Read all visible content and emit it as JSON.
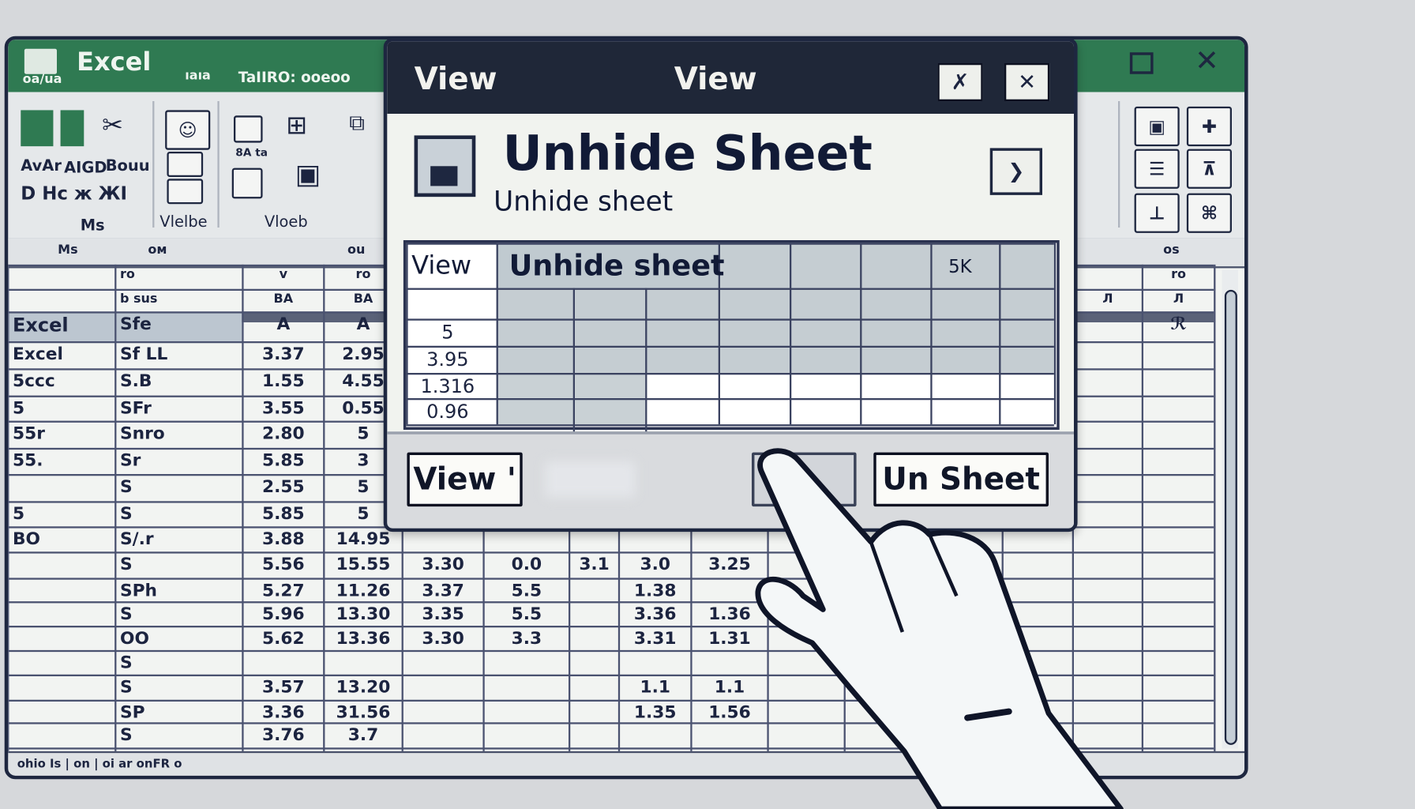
{
  "colors": {
    "excel_green": "#2f7a52",
    "dialog_title": "#1f2738",
    "grid_line": "#4a5270",
    "selection": "#bcc6d0"
  },
  "titlebar": {
    "app_name": "Excel",
    "left_caption": "oa/ua",
    "mid_caption": "ıaıa",
    "right_caption": "TaIIRO: ооеоо",
    "maximize_icon": "maximize-icon",
    "close_icon": "close-icon"
  },
  "ribbon": {
    "group_labels": [
      "Ms",
      "Vlelbe",
      "Vloeb"
    ],
    "small_text": [
      "AvAr",
      "AIGD",
      "Воuu",
      "D Hc ж ЖI",
      "8А ta"
    ]
  },
  "colstrip": {
    "labels": [
      "Ms",
      "ом",
      "ou",
      "os"
    ]
  },
  "sheet": {
    "rows": [
      [
        "",
        "ro",
        "v",
        "ro",
        "",
        "",
        "",
        "",
        "",
        "",
        "",
        "",
        "",
        "",
        "ro"
      ],
      [
        "",
        "b sus",
        "BA",
        "BA",
        "",
        "",
        "",
        "",
        "",
        "",
        "",
        "",
        "",
        "Л",
        "Л"
      ],
      [
        "Excel",
        "Sfe",
        "A",
        "A",
        "",
        "",
        "",
        "",
        "",
        "",
        "",
        "",
        "",
        "",
        "ℛ"
      ],
      [
        "Excel",
        "Sf LL",
        "3.37",
        "2.95"
      ],
      [
        "5ccc",
        "S.B",
        "1.55",
        "4.55"
      ],
      [
        "5",
        "SFr",
        "3.55",
        "0.55"
      ],
      [
        "55r",
        "Snro",
        "2.80",
        "5"
      ],
      [
        "55.",
        "Sr",
        "5.85",
        "3"
      ],
      [
        "",
        "S",
        "2.55",
        "5"
      ],
      [
        "5",
        "S",
        "5.85",
        "5"
      ],
      [
        "BO",
        "S/.r",
        "3.88",
        "14.95"
      ],
      [
        "",
        "S",
        "5.56",
        "15.55",
        "3.30",
        "0.0",
        "3.1",
        "3.0",
        "3.25"
      ],
      [
        "",
        "SPh",
        "5.27",
        "11.26",
        "3.37",
        "5.5",
        "",
        "1.38",
        ""
      ],
      [
        "",
        "S",
        "5.96",
        "13.30",
        "3.35",
        "5.5",
        "",
        "3.36",
        "1.36"
      ],
      [
        "",
        "OO",
        "5.62",
        "13.36",
        "3.30",
        "3.3",
        "",
        "3.31",
        "1.31"
      ],
      [
        "",
        "S",
        "",
        "",
        "",
        "",
        "",
        "",
        ""
      ],
      [
        "",
        "S",
        "3.57",
        "13.20",
        "",
        "",
        "",
        "1.1",
        "1.1"
      ],
      [
        "",
        "SP",
        "3.36",
        "31.56",
        "",
        "",
        "",
        "1.35",
        "1.56"
      ],
      [
        "",
        "S",
        "3.76",
        "3.7"
      ]
    ]
  },
  "statusbar": {
    "text": "ohio Is | on  |  oi  ar  onFR  o"
  },
  "dialog": {
    "title_left": "View",
    "title_center": "View",
    "pin_icon": "pin-icon",
    "close_icon": "close-icon",
    "heading": "Unhide Sheet",
    "subheading": "Unhide sheet",
    "sheet_icon": "sheet-icon",
    "next_icon": "chevron-right-icon",
    "table": {
      "header": [
        "View",
        "Unhide sheet",
        "5K"
      ],
      "first_col": [
        "",
        "5",
        "3.95",
        "1.316",
        "0.96"
      ]
    },
    "buttons": {
      "view": "View '",
      "blank": "",
      "unhide": "Un Sheet"
    }
  },
  "cursor": {
    "icon": "pointing-hand-icon"
  }
}
